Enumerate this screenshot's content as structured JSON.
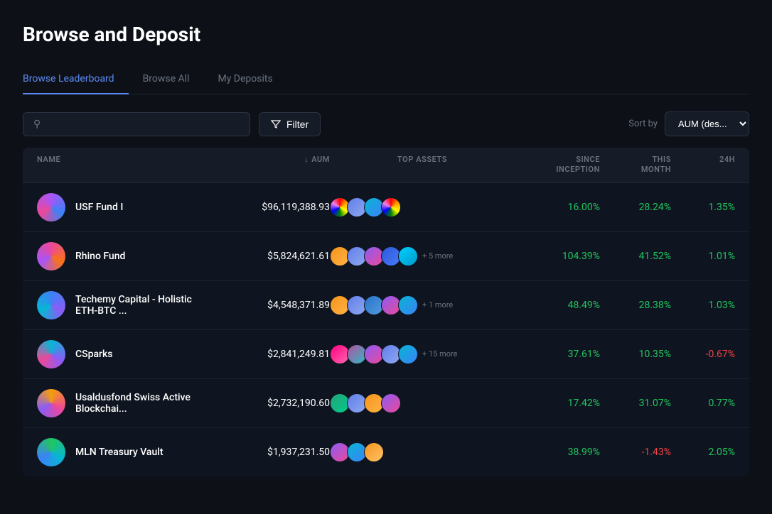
{
  "page": {
    "title": "Browse and Deposit"
  },
  "tabs": [
    {
      "id": "browse-leaderboard",
      "label": "Browse Leaderboard",
      "active": true
    },
    {
      "id": "browse-all",
      "label": "Browse All",
      "active": false
    },
    {
      "id": "my-deposits",
      "label": "My Deposits",
      "active": false
    }
  ],
  "controls": {
    "search_placeholder": "",
    "filter_label": "Filter",
    "sort_label": "Sort by",
    "sort_value": "AUM (des..."
  },
  "table": {
    "headers": {
      "name": "NAME",
      "aum": "AUM",
      "top_assets": "TOP ASSETS",
      "since_inception": "SINCE INCEPTION",
      "this_month": "THIS MONTH",
      "24h": "24H"
    },
    "rows": [
      {
        "id": "usf-fund-i",
        "name": "USF Fund I",
        "aum": "$96,119,388.93",
        "assets_count": null,
        "since_inception": "16.00%",
        "this_month": "28.24%",
        "24h": "1.35%",
        "since_inception_positive": true,
        "this_month_positive": true,
        "24h_positive": true
      },
      {
        "id": "rhino-fund",
        "name": "Rhino Fund",
        "aum": "$5,824,621.61",
        "assets_count": "+ 5 more",
        "since_inception": "104.39%",
        "this_month": "41.52%",
        "24h": "1.01%",
        "since_inception_positive": true,
        "this_month_positive": true,
        "24h_positive": true
      },
      {
        "id": "techemy",
        "name": "Techemy Capital - Holistic ETH-BTC ...",
        "aum": "$4,548,371.89",
        "assets_count": "+ 1 more",
        "since_inception": "48.49%",
        "this_month": "28.38%",
        "24h": "1.03%",
        "since_inception_positive": true,
        "this_month_positive": true,
        "24h_positive": true
      },
      {
        "id": "csparks",
        "name": "CSparks",
        "aum": "$2,841,249.81",
        "assets_count": "+ 15 more",
        "since_inception": "37.61%",
        "this_month": "10.35%",
        "24h": "-0.67%",
        "since_inception_positive": true,
        "this_month_positive": true,
        "24h_positive": false
      },
      {
        "id": "usaldusfond",
        "name": "Usaldusfond Swiss Active Blockchai...",
        "aum": "$2,732,190.60",
        "assets_count": null,
        "since_inception": "17.42%",
        "this_month": "31.07%",
        "24h": "0.77%",
        "since_inception_positive": true,
        "this_month_positive": true,
        "24h_positive": true
      },
      {
        "id": "mln-treasury",
        "name": "MLN Treasury Vault",
        "aum": "$1,937,231.50",
        "assets_count": null,
        "since_inception": "38.99%",
        "this_month": "-1.43%",
        "24h": "2.05%",
        "since_inception_positive": true,
        "this_month_positive": false,
        "24h_positive": true
      }
    ]
  }
}
